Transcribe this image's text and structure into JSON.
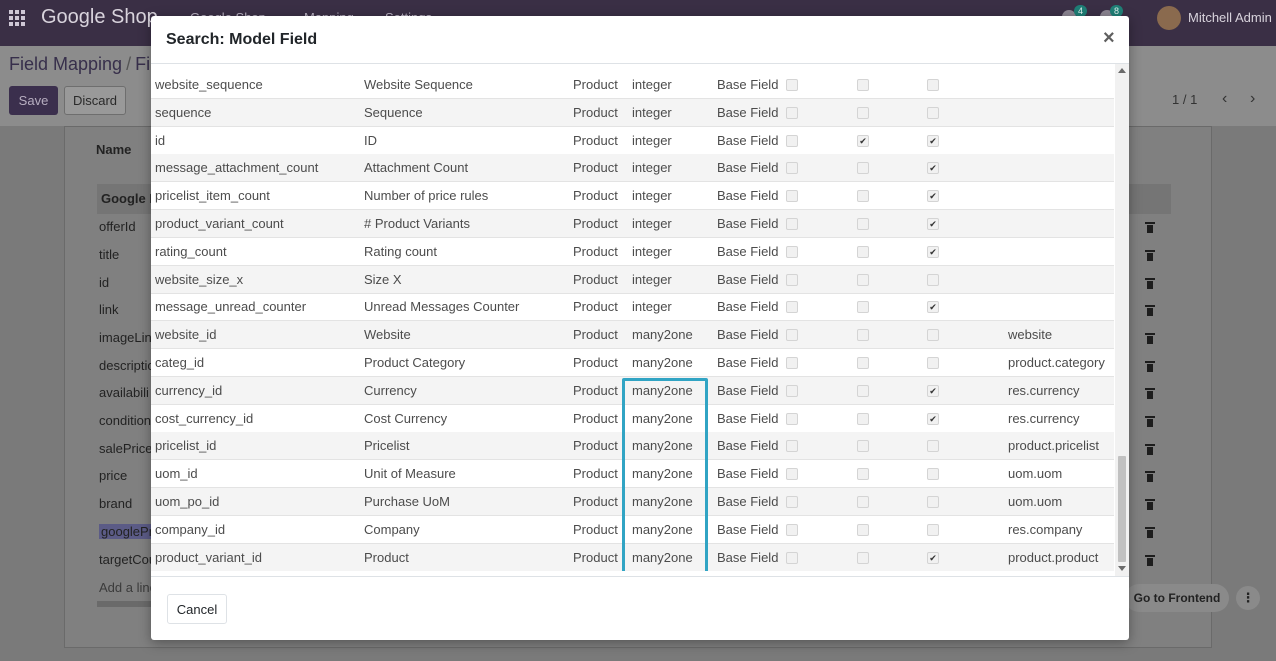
{
  "navbar": {
    "brand": "Google Shop",
    "menu": [
      "Google Shop",
      "Mapping",
      "Settings"
    ],
    "activity_count": "4",
    "messages_count": "8",
    "user_name": "Mitchell Admin"
  },
  "control_panel": {
    "breadcrumb_root": "Field Mapping",
    "breadcrumb_current": "Fi",
    "save_label": "Save",
    "discard_label": "Discard",
    "pager": "1 / 1"
  },
  "sheet": {
    "name_label": "Name",
    "lines_header": "Google F",
    "lines": [
      "offerId",
      "title",
      "id",
      "link",
      "imageLin",
      "descriptio",
      "availabili",
      "condition",
      "salePrice",
      "price",
      "brand",
      "googlePr",
      "targetCou"
    ],
    "add_line": "Add a line",
    "go_to_frontend": "Go to Frontend"
  },
  "modal": {
    "title": "Search: Model Field",
    "close_symbol": "×",
    "cancel_label": "Cancel",
    "check_symbol": "✔",
    "rows": [
      {
        "name": "website_sequence",
        "desc": "Website Sequence",
        "model": "Product",
        "type": "integer",
        "origin": "Base Field",
        "c1": false,
        "c2": false,
        "c3": false,
        "relation": ""
      },
      {
        "name": "sequence",
        "desc": "Sequence",
        "model": "Product",
        "type": "integer",
        "origin": "Base Field",
        "c1": false,
        "c2": false,
        "c3": false,
        "relation": ""
      },
      {
        "name": "id",
        "desc": "ID",
        "model": "Product",
        "type": "integer",
        "origin": "Base Field",
        "c1": false,
        "c2": true,
        "c3": true,
        "relation": ""
      },
      {
        "name": "message_attachment_count",
        "desc": "Attachment Count",
        "model": "Product",
        "type": "integer",
        "origin": "Base Field",
        "c1": false,
        "c2": false,
        "c3": true,
        "relation": ""
      },
      {
        "name": "pricelist_item_count",
        "desc": "Number of price rules",
        "model": "Product",
        "type": "integer",
        "origin": "Base Field",
        "c1": false,
        "c2": false,
        "c3": true,
        "relation": ""
      },
      {
        "name": "product_variant_count",
        "desc": "# Product Variants",
        "model": "Product",
        "type": "integer",
        "origin": "Base Field",
        "c1": false,
        "c2": false,
        "c3": true,
        "relation": ""
      },
      {
        "name": "rating_count",
        "desc": "Rating count",
        "model": "Product",
        "type": "integer",
        "origin": "Base Field",
        "c1": false,
        "c2": false,
        "c3": true,
        "relation": ""
      },
      {
        "name": "website_size_x",
        "desc": "Size X",
        "model": "Product",
        "type": "integer",
        "origin": "Base Field",
        "c1": false,
        "c2": false,
        "c3": false,
        "relation": ""
      },
      {
        "name": "message_unread_counter",
        "desc": "Unread Messages Counter",
        "model": "Product",
        "type": "integer",
        "origin": "Base Field",
        "c1": false,
        "c2": false,
        "c3": true,
        "relation": ""
      },
      {
        "name": "website_id",
        "desc": "Website",
        "model": "Product",
        "type": "many2one",
        "origin": "Base Field",
        "c1": false,
        "c2": false,
        "c3": false,
        "relation": "website"
      },
      {
        "name": "categ_id",
        "desc": "Product Category",
        "model": "Product",
        "type": "many2one",
        "origin": "Base Field",
        "c1": false,
        "c2": false,
        "c3": false,
        "relation": "product.category"
      },
      {
        "name": "currency_id",
        "desc": "Currency",
        "model": "Product",
        "type": "many2one",
        "origin": "Base Field",
        "c1": false,
        "c2": false,
        "c3": true,
        "relation": "res.currency"
      },
      {
        "name": "cost_currency_id",
        "desc": "Cost Currency",
        "model": "Product",
        "type": "many2one",
        "origin": "Base Field",
        "c1": false,
        "c2": false,
        "c3": true,
        "relation": "res.currency"
      },
      {
        "name": "pricelist_id",
        "desc": "Pricelist",
        "model": "Product",
        "type": "many2one",
        "origin": "Base Field",
        "c1": false,
        "c2": false,
        "c3": false,
        "relation": "product.pricelist"
      },
      {
        "name": "uom_id",
        "desc": "Unit of Measure",
        "model": "Product",
        "type": "many2one",
        "origin": "Base Field",
        "c1": false,
        "c2": false,
        "c3": false,
        "relation": "uom.uom"
      },
      {
        "name": "uom_po_id",
        "desc": "Purchase UoM",
        "model": "Product",
        "type": "many2one",
        "origin": "Base Field",
        "c1": false,
        "c2": false,
        "c3": false,
        "relation": "uom.uom"
      },
      {
        "name": "company_id",
        "desc": "Company",
        "model": "Product",
        "type": "many2one",
        "origin": "Base Field",
        "c1": false,
        "c2": false,
        "c3": false,
        "relation": "res.company"
      },
      {
        "name": "product_variant_id",
        "desc": "Product",
        "model": "Product",
        "type": "many2one",
        "origin": "Base Field",
        "c1": false,
        "c2": false,
        "c3": true,
        "relation": "product.product"
      }
    ]
  },
  "colors": {
    "navbar": "#3a2f45",
    "highlight_outline": "#31a4c4",
    "primary_button": "#3b2f4d"
  }
}
